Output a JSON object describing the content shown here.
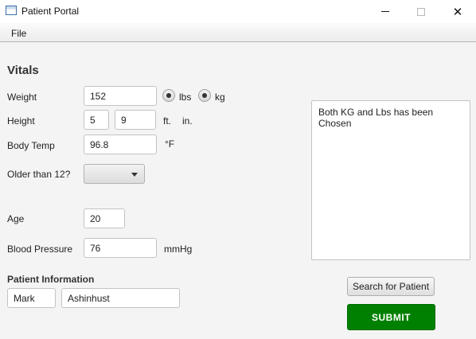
{
  "window": {
    "title": "Patient Portal",
    "minimize_icon": "minimize-icon",
    "maximize_icon": "maximize-icon",
    "close_icon": "close-icon",
    "close_glyph": "✕"
  },
  "menu": {
    "file": "File"
  },
  "vitals": {
    "heading": "Vitals",
    "weight": {
      "label": "Weight",
      "value": "152",
      "unit_lbs": "lbs",
      "unit_kg": "kg",
      "lbs_selected": true,
      "kg_selected": true
    },
    "height": {
      "label": "Height",
      "feet": "5",
      "inches": "9",
      "unit_ft": "ft.",
      "unit_in": "in."
    },
    "body_temp": {
      "label": "Body Temp",
      "value": "96.8",
      "unit": "°F"
    },
    "older_than_12": {
      "label": "Older than 12?",
      "selected": ""
    },
    "age": {
      "label": "Age",
      "value": "20"
    },
    "blood_pressure": {
      "label": "Blood Pressure",
      "value": "76",
      "unit": "mmHg"
    }
  },
  "patient_info": {
    "heading": "Patient Information",
    "first_name": "Mark",
    "last_name": "Ashinhust"
  },
  "output": {
    "message": "Both KG and Lbs has been Chosen"
  },
  "buttons": {
    "search": "Search for Patient",
    "submit": "SUBMIT"
  },
  "colors": {
    "submit_bg": "#008000",
    "submit_text": "#ffffff"
  }
}
